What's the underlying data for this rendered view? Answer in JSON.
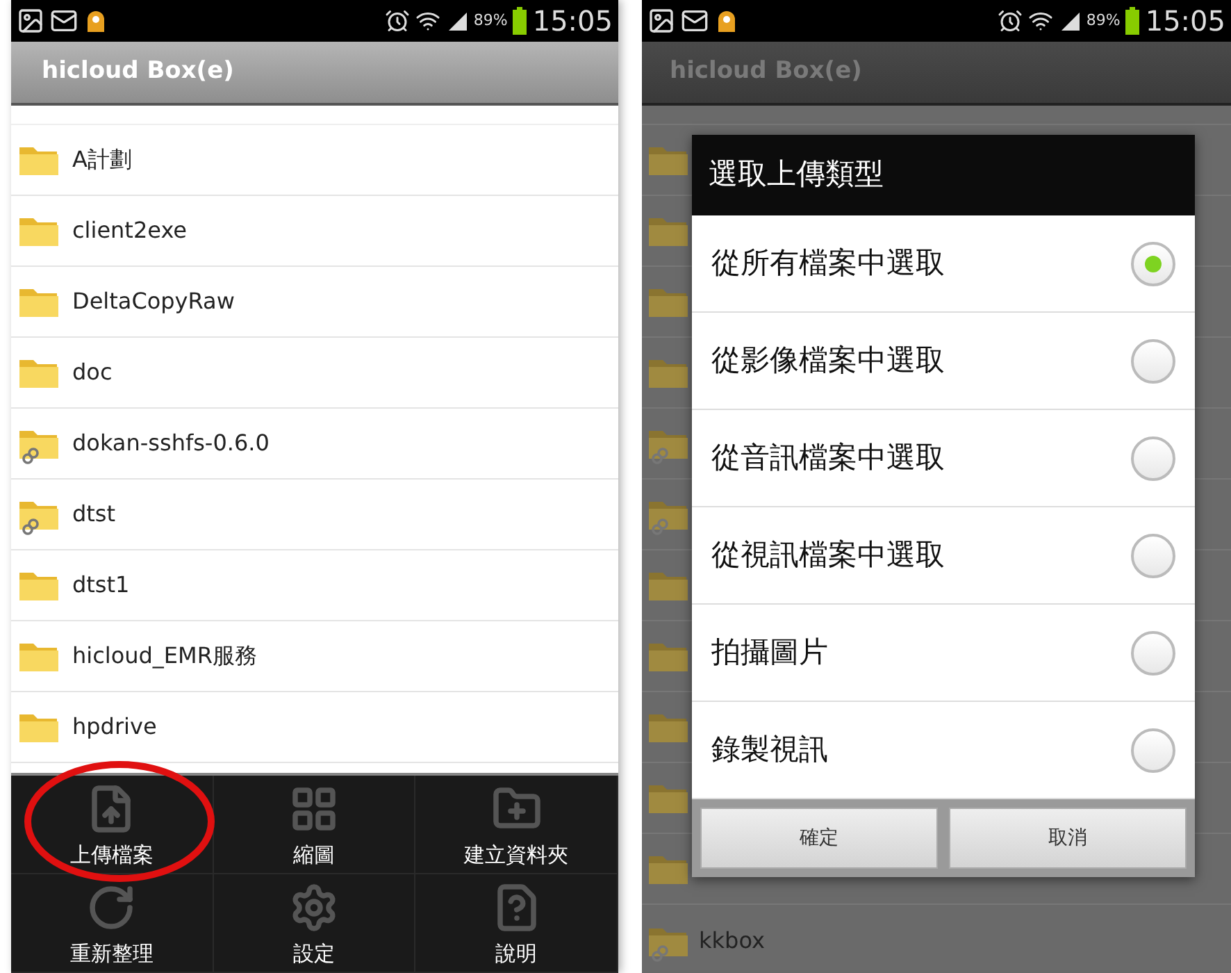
{
  "left_screen": {
    "status_bar": {
      "battery": "89%",
      "time": "15:05"
    },
    "title": "hicloud Box(e)",
    "folders": [
      {
        "name": "A計劃",
        "linked": false
      },
      {
        "name": "client2exe",
        "linked": false
      },
      {
        "name": "DeltaCopyRaw",
        "linked": false
      },
      {
        "name": "doc",
        "linked": false
      },
      {
        "name": "dokan-sshfs-0.6.0",
        "linked": true
      },
      {
        "name": "dtst",
        "linked": true
      },
      {
        "name": "dtst1",
        "linked": false
      },
      {
        "name": "hicloud_EMR服務",
        "linked": false
      },
      {
        "name": "hpdrive",
        "linked": false
      }
    ],
    "menu": [
      {
        "label": "上傳檔案",
        "highlighted": true
      },
      {
        "label": "縮圖",
        "highlighted": false
      },
      {
        "label": "建立資料夾",
        "highlighted": false
      },
      {
        "label": "重新整理",
        "highlighted": false
      },
      {
        "label": "設定",
        "highlighted": false
      },
      {
        "label": "說明",
        "highlighted": false
      }
    ]
  },
  "right_screen": {
    "status_bar": {
      "battery": "89%",
      "time": "15:05"
    },
    "title": "hicloud Box(e)",
    "last_folder": "kkbox",
    "dialog": {
      "title": "選取上傳類型",
      "options": [
        {
          "label": "從所有檔案中選取",
          "selected": true
        },
        {
          "label": "從影像檔案中選取",
          "selected": false
        },
        {
          "label": "從音訊檔案中選取",
          "selected": false
        },
        {
          "label": "從視訊檔案中選取",
          "selected": false
        },
        {
          "label": "拍攝圖片",
          "selected": false
        },
        {
          "label": "錄製視訊",
          "selected": false
        }
      ],
      "buttons": [
        "確定",
        "取消"
      ]
    }
  }
}
